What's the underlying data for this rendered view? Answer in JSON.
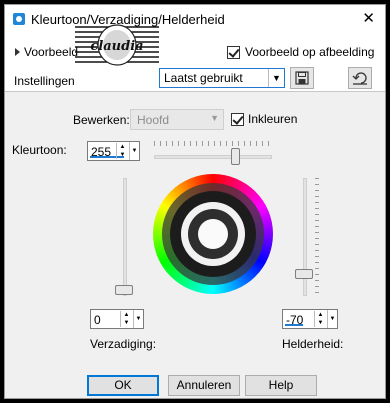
{
  "window": {
    "title": "Kleurtoon/Verzadiging/Helderheid",
    "close_glyph": "✕"
  },
  "preview": {
    "expander_label": "Voorbeeld",
    "checkbox_label": "Voorbeeld op afbeelding",
    "checked": true
  },
  "settings": {
    "label": "Instellingen",
    "preset_value": "Laatst gebruikt"
  },
  "logo": {
    "text": "claudia"
  },
  "edit": {
    "label": "Bewerken:",
    "value": "Hoofd",
    "colorize_label": "Inkleuren",
    "colorize_checked": true
  },
  "hue": {
    "label": "Kleurtoon:",
    "value": "255"
  },
  "saturation": {
    "label": "Verzadiging:",
    "value": "0"
  },
  "lightness": {
    "label": "Helderheid:",
    "value": "-70"
  },
  "buttons": {
    "ok": "OK",
    "cancel": "Annuleren",
    "help": "Help"
  },
  "icons": {
    "app": "app-icon",
    "save": "save-icon",
    "reset": "reset-icon"
  }
}
